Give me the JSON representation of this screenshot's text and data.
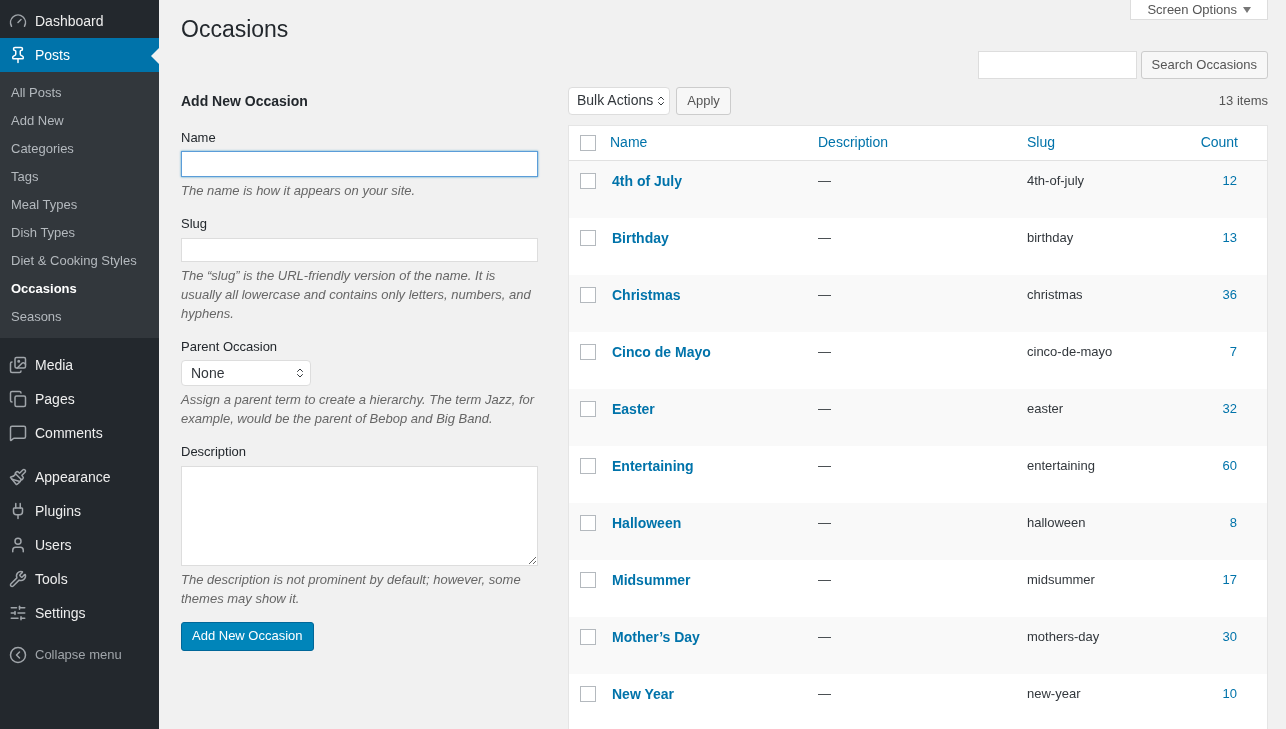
{
  "sidebar": {
    "items": [
      {
        "label": "Dashboard",
        "selected": false
      },
      {
        "label": "Posts",
        "selected": true,
        "children": [
          {
            "label": "All Posts",
            "selected": false
          },
          {
            "label": "Add New",
            "selected": false
          },
          {
            "label": "Categories",
            "selected": false
          },
          {
            "label": "Tags",
            "selected": false
          },
          {
            "label": "Meal Types",
            "selected": false
          },
          {
            "label": "Dish Types",
            "selected": false
          },
          {
            "label": "Diet & Cooking Styles",
            "selected": false
          },
          {
            "label": "Occasions",
            "selected": true
          },
          {
            "label": "Seasons",
            "selected": false
          }
        ]
      },
      {
        "label": "Media",
        "selected": false
      },
      {
        "label": "Pages",
        "selected": false
      },
      {
        "label": "Comments",
        "selected": false
      },
      {
        "label": "Appearance",
        "selected": false
      },
      {
        "label": "Plugins",
        "selected": false
      },
      {
        "label": "Users",
        "selected": false
      },
      {
        "label": "Tools",
        "selected": false
      },
      {
        "label": "Settings",
        "selected": false
      }
    ],
    "collapse": "Collapse menu"
  },
  "page_title": "Occasions",
  "screen_options": "Screen Options",
  "search": {
    "button": "Search Occasions"
  },
  "form": {
    "heading": "Add New Occasion",
    "name": {
      "label": "Name",
      "hint": "The name is how it appears on your site."
    },
    "slug": {
      "label": "Slug",
      "hint": "The “slug” is the URL-friendly version of the name. It is usually all lowercase and contains only letters, numbers, and hyphens."
    },
    "parent": {
      "label": "Parent Occasion",
      "value": "None",
      "hint": "Assign a parent term to create a hierarchy. The term Jazz, for example, would be the parent of Bebop and Big Band."
    },
    "description": {
      "label": "Description",
      "hint": "The description is not prominent by default; however, some themes may show it."
    },
    "submit": "Add New Occasion"
  },
  "table": {
    "select_all_checked": false,
    "bulk_actions": "Bulk Actions",
    "apply": "Apply",
    "item_count": "13 items",
    "columns": [
      "Name",
      "Description",
      "Slug",
      "Count"
    ],
    "rows": [
      {
        "name": "4th of July",
        "description": "—",
        "slug": "4th-of-july",
        "count": "12",
        "checked": false
      },
      {
        "name": "Birthday",
        "description": "—",
        "slug": "birthday",
        "count": "13",
        "checked": false
      },
      {
        "name": "Christmas",
        "description": "—",
        "slug": "christmas",
        "count": "36",
        "checked": false
      },
      {
        "name": "Cinco de Mayo",
        "description": "—",
        "slug": "cinco-de-mayo",
        "count": "7",
        "checked": false
      },
      {
        "name": "Easter",
        "description": "—",
        "slug": "easter",
        "count": "32",
        "checked": false
      },
      {
        "name": "Entertaining",
        "description": "—",
        "slug": "entertaining",
        "count": "60",
        "checked": false
      },
      {
        "name": "Halloween",
        "description": "—",
        "slug": "halloween",
        "count": "8",
        "checked": false
      },
      {
        "name": "Midsummer",
        "description": "—",
        "slug": "midsummer",
        "count": "17",
        "checked": false
      },
      {
        "name": "Mother’s Day",
        "description": "—",
        "slug": "mothers-day",
        "count": "30",
        "checked": false
      },
      {
        "name": "New Year",
        "description": "—",
        "slug": "new-year",
        "count": "10",
        "checked": false
      }
    ]
  }
}
